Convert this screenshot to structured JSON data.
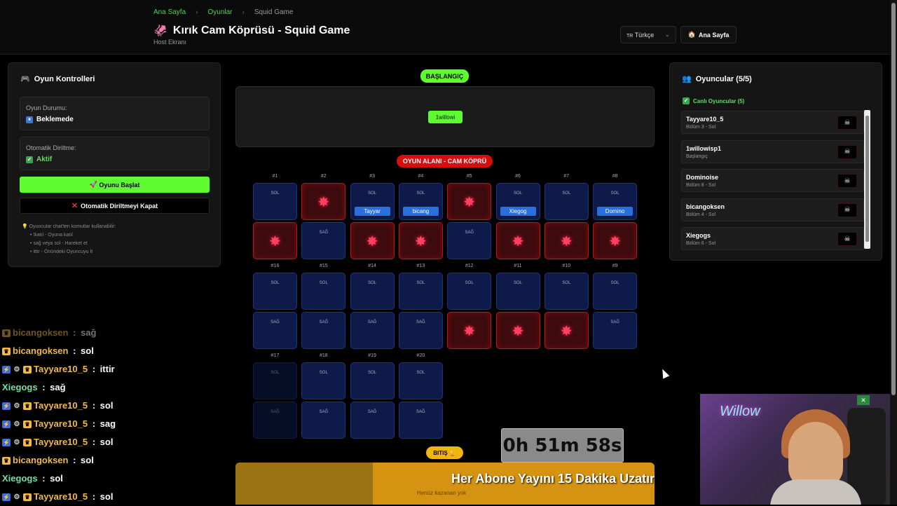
{
  "header": {
    "breadcrumb": [
      "Ana Sayfa",
      "Oyunlar",
      "Squid Game"
    ],
    "title": "Kırık Cam Köprüsü - Squid Game",
    "subtitle": "Host Ekranı",
    "language": "Türkçe",
    "home_label": "Ana Sayfa"
  },
  "controls": {
    "title": "Oyun Kontrolleri",
    "status_label": "Oyun Durumu:",
    "status_value": "Beklemede",
    "revive_label": "Otomatik Diriltme:",
    "revive_value": "Aktif",
    "start_label": "Oyunu Başlat",
    "close_revive_label": "Otomatik Diriltmeyi Kapat",
    "help_title": "Oyuncular chat'ten komutlar kullanabilir:",
    "help_items": [
      "!katıl - Oyuna katıl",
      "sağ veya sol - Hareket et",
      "ittir - Önündeki Oyuncuyu İt"
    ]
  },
  "board": {
    "start_label": "BAŞLANGIÇ",
    "start_player": "1willowi",
    "area_label": "OYUN ALANI - CAM KÖPRÜ",
    "finish_label": "BITIŞ",
    "no_winner": "Henüz kazanan yok",
    "rows": [
      {
        "nums": [
          "#1",
          "#2",
          "#3",
          "#4",
          "#5",
          "#6",
          "#7",
          "#8"
        ],
        "top": [
          {
            "s": "safe",
            "t": "SOL"
          },
          {
            "s": "broken"
          },
          {
            "s": "safe",
            "t": "SOL",
            "p": "Tayyar"
          },
          {
            "s": "safe",
            "t": "SOL",
            "p": "bicang"
          },
          {
            "s": "broken"
          },
          {
            "s": "safe",
            "t": "SOL",
            "p": "Xiegog"
          },
          {
            "s": "safe",
            "t": "SOL"
          },
          {
            "s": "safe",
            "t": "SOL",
            "p": "Domino"
          }
        ],
        "bottom": [
          {
            "s": "broken"
          },
          {
            "s": "safe",
            "t": "SAĞ"
          },
          {
            "s": "broken"
          },
          {
            "s": "broken"
          },
          {
            "s": "safe",
            "t": "SAĞ"
          },
          {
            "s": "broken"
          },
          {
            "s": "broken"
          },
          {
            "s": "broken"
          }
        ]
      },
      {
        "nums": [
          "#16",
          "#15",
          "#14",
          "#13",
          "#12",
          "#11",
          "#10",
          "#9"
        ],
        "top": [
          {
            "s": "safe",
            "t": "SOL"
          },
          {
            "s": "safe",
            "t": "SOL"
          },
          {
            "s": "safe",
            "t": "SOL"
          },
          {
            "s": "safe",
            "t": "SOL"
          },
          {
            "s": "safe",
            "t": "SOL"
          },
          {
            "s": "safe",
            "t": "SOL"
          },
          {
            "s": "safe",
            "t": "SOL"
          },
          {
            "s": "safe",
            "t": "SOL"
          }
        ],
        "bottom": [
          {
            "s": "safe",
            "t": "SAĞ"
          },
          {
            "s": "safe",
            "t": "SAĞ"
          },
          {
            "s": "safe",
            "t": "SAĞ"
          },
          {
            "s": "safe",
            "t": "SAĞ"
          },
          {
            "s": "broken"
          },
          {
            "s": "broken"
          },
          {
            "s": "broken"
          },
          {
            "s": "safe",
            "t": "SAĞ"
          }
        ]
      },
      {
        "nums": [
          "#17",
          "#18",
          "#19",
          "#20"
        ],
        "top": [
          {
            "s": "safe",
            "t": "SOL"
          },
          {
            "s": "safe",
            "t": "SOL"
          },
          {
            "s": "safe",
            "t": "SOL"
          },
          {
            "s": "safe",
            "t": "SOL"
          }
        ],
        "bottom": [
          {
            "s": "safe",
            "t": "SAĞ"
          },
          {
            "s": "safe",
            "t": "SAĞ"
          },
          {
            "s": "safe",
            "t": "SAĞ"
          },
          {
            "s": "safe",
            "t": "SAĞ"
          }
        ]
      }
    ]
  },
  "players": {
    "title": "Oyuncular (5/5)",
    "live_label": "Canlı Oyuncular (5)",
    "list": [
      {
        "name": "Tayyare10_5",
        "status": "Bölüm 3 - Sol"
      },
      {
        "name": "1willowisp1",
        "status": "Başlangıç"
      },
      {
        "name": "Dominoise",
        "status": "Bölüm 8 - Sol"
      },
      {
        "name": "bicangoksen",
        "status": "Bölüm 4 - Sol"
      },
      {
        "name": "Xiegogs",
        "status": "Bölüm 6 - Sol"
      }
    ]
  },
  "chat": [
    {
      "user": "bicangoksen",
      "msg": "sağ",
      "color": "gold",
      "badges": [
        "b2"
      ],
      "dim": true
    },
    {
      "user": "bicangoksen",
      "msg": "sol",
      "color": "gold",
      "badges": [
        "b2"
      ]
    },
    {
      "user": "Tayyare10_5",
      "msg": "ittir",
      "color": "gold",
      "badges": [
        "b1",
        "b3",
        "b2"
      ]
    },
    {
      "user": "Xiegogs",
      "msg": "sağ",
      "color": "teal",
      "badges": []
    },
    {
      "user": "Tayyare10_5",
      "msg": "sol",
      "color": "gold",
      "badges": [
        "b1",
        "b3",
        "b2"
      ]
    },
    {
      "user": "Tayyare10_5",
      "msg": "sag",
      "color": "gold",
      "badges": [
        "b1",
        "b3",
        "b2"
      ]
    },
    {
      "user": "Tayyare10_5",
      "msg": "sol",
      "color": "gold",
      "badges": [
        "b1",
        "b3",
        "b2"
      ]
    },
    {
      "user": "bicangoksen",
      "msg": "sol",
      "color": "gold",
      "badges": [
        "b2"
      ]
    },
    {
      "user": "Xiegogs",
      "msg": "sol",
      "color": "teal",
      "badges": []
    },
    {
      "user": "Tayyare10_5",
      "msg": "sol",
      "color": "gold",
      "badges": [
        "b1",
        "b3",
        "b2"
      ]
    }
  ],
  "overlay": {
    "timer": "0h 51m 58s",
    "abone_text": "Her Abone Yayını 15 Dakika Uzatır",
    "webcam_sign": "Willow"
  },
  "colors": {
    "accent": "#5dfb2f",
    "danger": "#d90d0d",
    "finish": "#f2b50d"
  }
}
